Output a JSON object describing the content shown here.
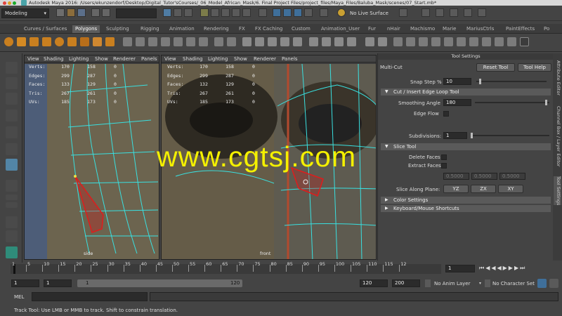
{
  "window": {
    "title": "Autodesk Maya 2016: /Users/ekunzendorf/Desktop/Digital_Tutor'sCourses/_06_Model_African_Mask/6. Final Project Files/project_files/Maya_Files/Baluba_Mask/scenes/07_Start.mb*"
  },
  "statusline": {
    "menu_set": "Modeling",
    "live_surface": "No Live Surface"
  },
  "shelf": {
    "tabs": [
      "Curves / Surfaces",
      "Polygons",
      "Sculpting",
      "Rigging",
      "Animation",
      "Rendering",
      "FX",
      "FX Caching",
      "Custom",
      "Animation_User",
      "Fur",
      "nHair",
      "Machismo",
      "Marie",
      "MariusCtrls",
      "PaintEffects",
      "Po"
    ]
  },
  "viewports": {
    "menu": [
      "View",
      "Shading",
      "Lighting",
      "Show",
      "Renderer",
      "Panels"
    ],
    "hud_labels": [
      "Verts:",
      "Edges:",
      "Faces:",
      "Tris:",
      "UVs:"
    ],
    "side": {
      "label": "side",
      "hud": [
        [
          "170",
          "158",
          "0"
        ],
        [
          "299",
          "287",
          "0"
        ],
        [
          "133",
          "129",
          "0"
        ],
        [
          "267",
          "261",
          "0"
        ],
        [
          "185",
          "173",
          "0"
        ]
      ]
    },
    "front": {
      "label": "front",
      "hud": [
        [
          "170",
          "158",
          "0"
        ],
        [
          "299",
          "287",
          "0"
        ],
        [
          "132",
          "129",
          "0"
        ],
        [
          "267",
          "261",
          "0"
        ],
        [
          "185",
          "173",
          "0"
        ]
      ]
    }
  },
  "watermark": "www.cgtsj.com",
  "tool_settings": {
    "panel_title": "Tool Settings",
    "tool_name": "Multi-Cut",
    "reset_button": "Reset Tool",
    "help_button": "Tool Help",
    "snap_step_label": "Snap Step %",
    "snap_step_value": "10",
    "section_cut": "Cut / Insert Edge Loop Tool",
    "smoothing_angle_label": "Smoothing Angle",
    "smoothing_angle_value": "180",
    "edge_flow_label": "Edge Flow",
    "subdivisions_label": "Subdivisions:",
    "subdivisions_value": "1",
    "section_slice": "Slice Tool",
    "delete_faces_label": "Delete Faces",
    "extract_faces_label": "Extract Faces",
    "extract_values": [
      "0.5000",
      "0.5000",
      "0.5000"
    ],
    "slice_plane_label": "Slice Along Plane:",
    "plane_buttons": [
      "YZ",
      "ZX",
      "XY"
    ],
    "section_color": "Color Settings",
    "section_shortcuts": "Keyboard/Mouse Shortcuts"
  },
  "side_tabs": [
    "Attribute Editor",
    "Channel Box / Layer Editor",
    "Tool Settings"
  ],
  "time_slider": {
    "ticks": [
      "5",
      "10",
      "15",
      "20",
      "25",
      "30",
      "35",
      "40",
      "45",
      "50",
      "55",
      "60",
      "65",
      "70",
      "75",
      "80",
      "85",
      "90",
      "95",
      "100",
      "105",
      "110",
      "115",
      "12"
    ],
    "current_frame_start": "1",
    "current_frame": "1"
  },
  "range": {
    "start": "1",
    "playback_start": "1",
    "range_inner_start": "1",
    "range_inner_end": "120",
    "end": "120",
    "anim_end": "200",
    "anim_layer": "No Anim Layer",
    "character_set": "No Character Set"
  },
  "command_line": {
    "label": "MEL"
  },
  "help_line": "Track Tool: Use LMB or MMB to track. Shift to constrain translation."
}
